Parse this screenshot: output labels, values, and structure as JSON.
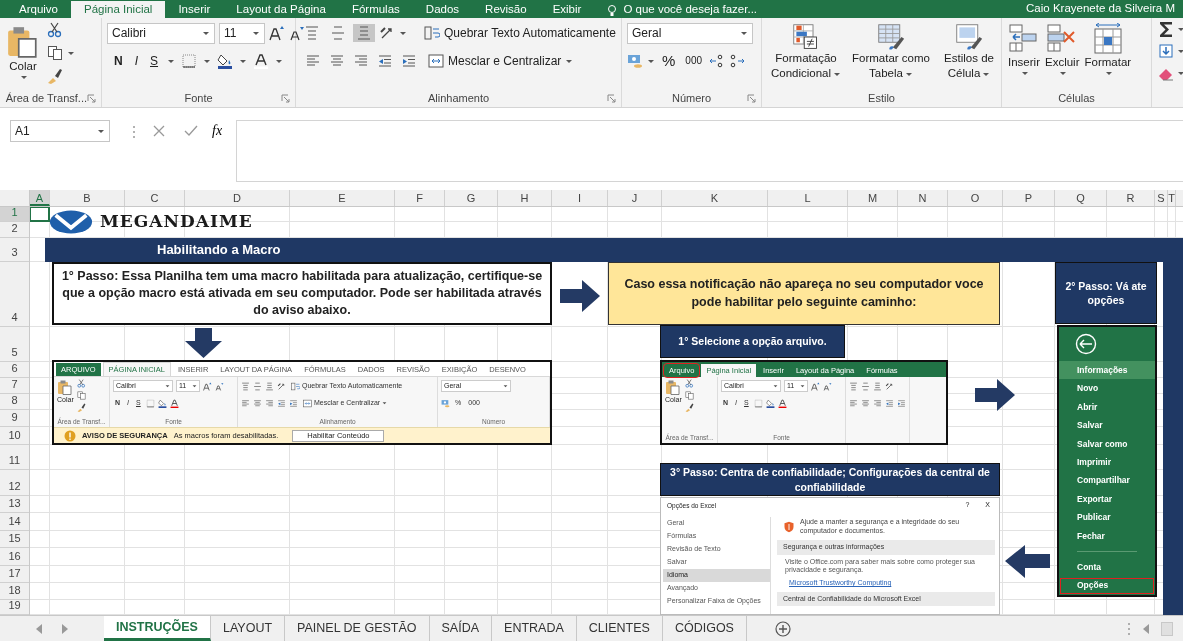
{
  "ribbon_tabs": [
    {
      "label": "Arquivo",
      "selected": false
    },
    {
      "label": "Página Inicial",
      "selected": true
    },
    {
      "label": "Inserir",
      "selected": false
    },
    {
      "label": "Layout da Página",
      "selected": false
    },
    {
      "label": "Fórmulas",
      "selected": false
    },
    {
      "label": "Dados",
      "selected": false
    },
    {
      "label": "Revisão",
      "selected": false
    },
    {
      "label": "Exibir",
      "selected": false
    }
  ],
  "tell_me": "O que você deseja fazer...",
  "user_name": "Caio Krayenete da Silveira M",
  "ribbon": {
    "paste": "Colar",
    "clipboard_group": "Área de Transf...",
    "font_name": "Calibri",
    "font_size": "11",
    "bold": "N",
    "italic": "I",
    "underline": "S",
    "font_group": "Fonte",
    "vertical_align": [
      {
        "pressed": false
      },
      {
        "pressed": false
      },
      {
        "pressed": true
      }
    ],
    "wrap_text": "Quebrar Texto Automaticamente",
    "merge": "Mesclar e Centralizar",
    "alignment_group": "Alinhamento",
    "number_format": "Geral",
    "percent": "%",
    "thousands": "000",
    "number_group": "Número",
    "style_buttons": [
      "Formatação Condicional",
      "Formatar como Tabela",
      "Estilos de Célula"
    ],
    "styles_group": "Estilo",
    "cell_buttons": [
      "Inserir",
      "Excluir",
      "Formatar"
    ],
    "cells_group": "Células"
  },
  "formula_bar": {
    "name_box": "A1",
    "function_label": "fx"
  },
  "columns": [
    {
      "label": "A",
      "selected": true
    },
    {
      "label": "B",
      "selected": false
    },
    {
      "label": "C",
      "selected": false
    },
    {
      "label": "D",
      "selected": false
    },
    {
      "label": "E",
      "selected": false
    },
    {
      "label": "F",
      "selected": false
    },
    {
      "label": "G",
      "selected": false
    },
    {
      "label": "H",
      "selected": false
    },
    {
      "label": "I",
      "selected": false
    },
    {
      "label": "J",
      "selected": false
    },
    {
      "label": "K",
      "selected": false
    },
    {
      "label": "L",
      "selected": false
    },
    {
      "label": "M",
      "selected": false
    },
    {
      "label": "N",
      "selected": false
    },
    {
      "label": "O",
      "selected": false
    },
    {
      "label": "P",
      "selected": false
    },
    {
      "label": "Q",
      "selected": false
    },
    {
      "label": "R",
      "selected": false
    },
    {
      "label": "S",
      "selected": false
    },
    {
      "label": "T",
      "selected": false
    }
  ],
  "rows": [
    {
      "label": "1",
      "selected": true
    },
    {
      "label": "2",
      "selected": false
    },
    {
      "label": "3",
      "selected": false
    },
    {
      "label": "4",
      "selected": false
    },
    {
      "label": "5",
      "selected": false
    },
    {
      "label": "6",
      "selected": false
    },
    {
      "label": "7",
      "selected": false
    },
    {
      "label": "8",
      "selected": false
    },
    {
      "label": "9",
      "selected": false
    },
    {
      "label": "10",
      "selected": false
    },
    {
      "label": "11",
      "selected": false
    },
    {
      "label": "12",
      "selected": false
    },
    {
      "label": "13",
      "selected": false
    },
    {
      "label": "14",
      "selected": false
    },
    {
      "label": "15",
      "selected": false
    },
    {
      "label": "16",
      "selected": false
    },
    {
      "label": "17",
      "selected": false
    },
    {
      "label": "18",
      "selected": false
    },
    {
      "label": "19",
      "selected": false
    }
  ],
  "logo": "MEGANDAIME",
  "banner": "Habilitando a Macro",
  "step_1": "1° Passo: Essa Planilha tem uma macro habilitada para atualização, certifique-se que a opção macro está ativada em seu computador. Pode ser habilitada através do aviso abaixo.",
  "macro_warning_screenshot": {
    "kind": "light",
    "tabs": [
      {
        "label": "ARQUIVO",
        "selected": false,
        "outlined": false
      },
      {
        "label": "PÁGINA INICIAL",
        "selected": true,
        "outlined": false
      },
      {
        "label": "INSERIR",
        "selected": false,
        "outlined": false
      },
      {
        "label": "LAYOUT DA PÁGINA",
        "selected": false,
        "outlined": false
      },
      {
        "label": "FÓRMULAS",
        "selected": false,
        "outlined": false
      },
      {
        "label": "DADOS",
        "selected": false,
        "outlined": false
      },
      {
        "label": "REVISÃO",
        "selected": false,
        "outlined": false
      },
      {
        "label": "EXIBIÇÃO",
        "selected": false,
        "outlined": false
      },
      {
        "label": "DESENVO",
        "selected": false,
        "outlined": false
      }
    ],
    "groups": [
      {
        "kind": "clipboard",
        "paste": "Colar",
        "label": "Área de Transf..."
      },
      {
        "kind": "font",
        "font_name": "Calibri",
        "font_size": "11",
        "bold": "N",
        "italic": "I",
        "underline": "S",
        "label": "Fonte"
      },
      {
        "kind": "alignment",
        "wrap_text": "Quebrar Texto Automaticamente",
        "merge": "Mesclar e Centralizar",
        "label": "Alinhamento"
      },
      {
        "kind": "number",
        "number_format": "Geral",
        "percent": "%",
        "thousands": "000",
        "label": "Número"
      }
    ],
    "security_bar": {
      "title": "AVISO DE SEGURANÇA",
      "message": "As macros foram desabilitadas.",
      "button": "Habilitar Conteúdo"
    }
  },
  "notice": "Caso essa notificação não apareça no seu computador voce pode habilitar pelo seguinte caminho:",
  "step_2": "2° Passo: Vá ate opções",
  "file_menu": [
    {
      "kind": "back"
    },
    {
      "kind": "item",
      "label": "Informações",
      "selected": true,
      "outlined": false
    },
    {
      "kind": "item",
      "label": "Novo",
      "selected": false,
      "outlined": false
    },
    {
      "kind": "item",
      "label": "Abrir",
      "selected": false,
      "outlined": false
    },
    {
      "kind": "item",
      "label": "Salvar",
      "selected": false,
      "outlined": false
    },
    {
      "kind": "item",
      "label": "Salvar como",
      "selected": false,
      "outlined": false
    },
    {
      "kind": "item",
      "label": "Imprimir",
      "selected": false,
      "outlined": false
    },
    {
      "kind": "item",
      "label": "Compartilhar",
      "selected": false,
      "outlined": false
    },
    {
      "kind": "item",
      "label": "Exportar",
      "selected": false,
      "outlined": false
    },
    {
      "kind": "item",
      "label": "Publicar",
      "selected": false,
      "outlined": false
    },
    {
      "kind": "item",
      "label": "Fechar",
      "selected": false,
      "outlined": false
    },
    {
      "kind": "separator"
    },
    {
      "kind": "item",
      "label": "Conta",
      "selected": false,
      "outlined": false
    },
    {
      "kind": "item",
      "label": "Opções",
      "selected": false,
      "outlined": true
    }
  ],
  "step_1b": "1° Selecione a opção arquivo.",
  "file_tab_screenshot": {
    "kind": "green",
    "tabs": [
      {
        "label": "Arquivo",
        "selected": false,
        "outlined": true
      },
      {
        "label": "Página Inicial",
        "selected": true,
        "outlined": false
      },
      {
        "label": "Inserir",
        "selected": false,
        "outlined": false
      },
      {
        "label": "Layout da Página",
        "selected": false,
        "outlined": false
      },
      {
        "label": "Fórmulas",
        "selected": false,
        "outlined": false
      }
    ],
    "groups": [
      {
        "kind": "clipboard",
        "paste": "Colar",
        "label": "Área de Transf..."
      },
      {
        "kind": "font",
        "font_name": "Calibri",
        "font_size": "11",
        "bold": "N",
        "italic": "I",
        "underline": "S",
        "label": "Fonte"
      },
      {
        "kind": "alignment"
      }
    ]
  },
  "step_3": "3°  Passo:  Centra de confiabilidade; Configurações da central de confiabilidade",
  "options_dialog_screenshot": {
    "title": "Opções do Excel",
    "help": "?",
    "close": "X",
    "nav": [
      {
        "label": "Geral",
        "selected": false
      },
      {
        "label": "Fórmulas",
        "selected": false
      },
      {
        "label": "Revisão de Texto",
        "selected": false
      },
      {
        "label": "Salvar",
        "selected": false
      },
      {
        "label": "Idioma",
        "selected": true
      },
      {
        "label": "Avançado",
        "selected": false
      },
      {
        "label": "Personalizar Faixa de Opções",
        "selected": false
      }
    ],
    "intro": "Ajude a manter a segurança e a integridade do seu computador e documentos.",
    "sections": [
      {
        "kind": "heading",
        "text": "Segurança e outras informações"
      },
      {
        "kind": "text",
        "text": "Visite o Office.com para saber mais sobre como proteger sua privacidade e segurança."
      },
      {
        "kind": "link",
        "text": "Microsoft Trustworthy Computing"
      },
      {
        "kind": "heading",
        "text": "Central de Confiabilidade do Microsoft Excel"
      }
    ]
  },
  "sheet_tabs": [
    {
      "label": "INSTRUÇÕES",
      "selected": true
    },
    {
      "label": "LAYOUT",
      "selected": false
    },
    {
      "label": "PAINEL DE GESTÃO",
      "selected": false
    },
    {
      "label": "SAÍDA",
      "selected": false
    },
    {
      "label": "ENTRADA",
      "selected": false
    },
    {
      "label": "CLIENTES",
      "selected": false
    },
    {
      "label": "CÓDIGOS",
      "selected": false
    }
  ]
}
